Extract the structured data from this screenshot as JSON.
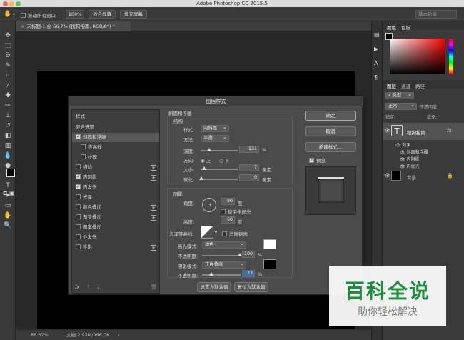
{
  "window": {
    "title": "Adobe Photoshop CC 2015.5"
  },
  "options_bar": {
    "scroll_all_label": "滚动所有窗口",
    "zoom": "100%",
    "fit_screen": "适合屏幕",
    "fill_screen": "填充屏幕",
    "workspace": "基本功能"
  },
  "document": {
    "tab": "未标题-1 @ 66.7% (搜狗指南, RGB/8*) *"
  },
  "status": {
    "zoom": "66.67%",
    "doc_size": "文档:2.93M/996.0K"
  },
  "right_panel": {
    "color_tabs": [
      "颜色",
      "色板"
    ],
    "layers_tabs": [
      "图层",
      "通道",
      "路径"
    ],
    "kind": "类型",
    "mode": "正常",
    "opacity_label": "不透明度:",
    "lock_label": "锁定:",
    "fill_label": "填充:",
    "text_layer": {
      "name": "搜狗指南",
      "fx": "fx",
      "effects_label": "效果",
      "effects": [
        "斜面和浮雕",
        "内阴影",
        "内发光"
      ]
    },
    "bg_layer": {
      "name": "背景"
    }
  },
  "dialog": {
    "title": "图层样式",
    "list_header": "样式",
    "blend_options": "混合选项",
    "styles": [
      {
        "label": "斜面和浮雕",
        "checked": true,
        "plus": false,
        "selected": true
      },
      {
        "label": "等高线",
        "checked": false,
        "plus": false,
        "sub": true
      },
      {
        "label": "纹理",
        "checked": false,
        "plus": false,
        "sub": true
      },
      {
        "label": "描边",
        "checked": false,
        "plus": true
      },
      {
        "label": "内阴影",
        "checked": true,
        "plus": true
      },
      {
        "label": "内发光",
        "checked": true,
        "plus": false
      },
      {
        "label": "光泽",
        "checked": false,
        "plus": false
      },
      {
        "label": "颜色叠加",
        "checked": false,
        "plus": true
      },
      {
        "label": "渐变叠加",
        "checked": false,
        "plus": true
      },
      {
        "label": "图案叠加",
        "checked": false,
        "plus": false
      },
      {
        "label": "外发光",
        "checked": false,
        "plus": false
      },
      {
        "label": "投影",
        "checked": false,
        "plus": true
      }
    ],
    "footer_icons": {
      "fx": "fx",
      "up": "⇡",
      "down": "⇣",
      "trash": "🗑"
    },
    "bevel": {
      "section": "斜面和浮雕",
      "structure": "结构",
      "style_label": "样式:",
      "style_value": "内斜面",
      "method_label": "方法:",
      "method_value": "平滑",
      "depth_label": "深度:",
      "depth_value": "131",
      "depth_unit": "%",
      "direction_label": "方向:",
      "dir_up": "上",
      "dir_down": "下",
      "size_label": "大小:",
      "size_value": "7",
      "size_unit": "像素",
      "soften_label": "软化:",
      "soften_value": "0",
      "soften_unit": "像素"
    },
    "shading": {
      "section": "阴影",
      "angle_label": "角度:",
      "angle_value": "90",
      "angle_unit": "度",
      "global_light": "使用全局光",
      "altitude_label": "高度:",
      "altitude_value": "60",
      "altitude_unit": "度",
      "gloss_label": "光泽等高线:",
      "anti_alias": "消除锯齿",
      "highlight_label": "高光模式:",
      "highlight_value": "滤色",
      "hl_opacity_label": "不透明度:",
      "hl_opacity_value": "100",
      "hl_opacity_unit": "%",
      "shadow_label": "阴影模式:",
      "shadow_value": "正片叠底",
      "sh_opacity_label": "不透明度:",
      "sh_opacity_value": "23",
      "sh_opacity_unit": "%"
    },
    "buttons": {
      "ok": "确定",
      "cancel": "取消",
      "new_style": "新建样式...",
      "preview": "预览",
      "make_default": "设置为默认值",
      "reset_default": "复位为默认值"
    }
  },
  "watermark": {
    "title": "百科全说",
    "subtitle": "助你轻松解决"
  },
  "colors": {
    "accent": "#1c8f3e"
  }
}
